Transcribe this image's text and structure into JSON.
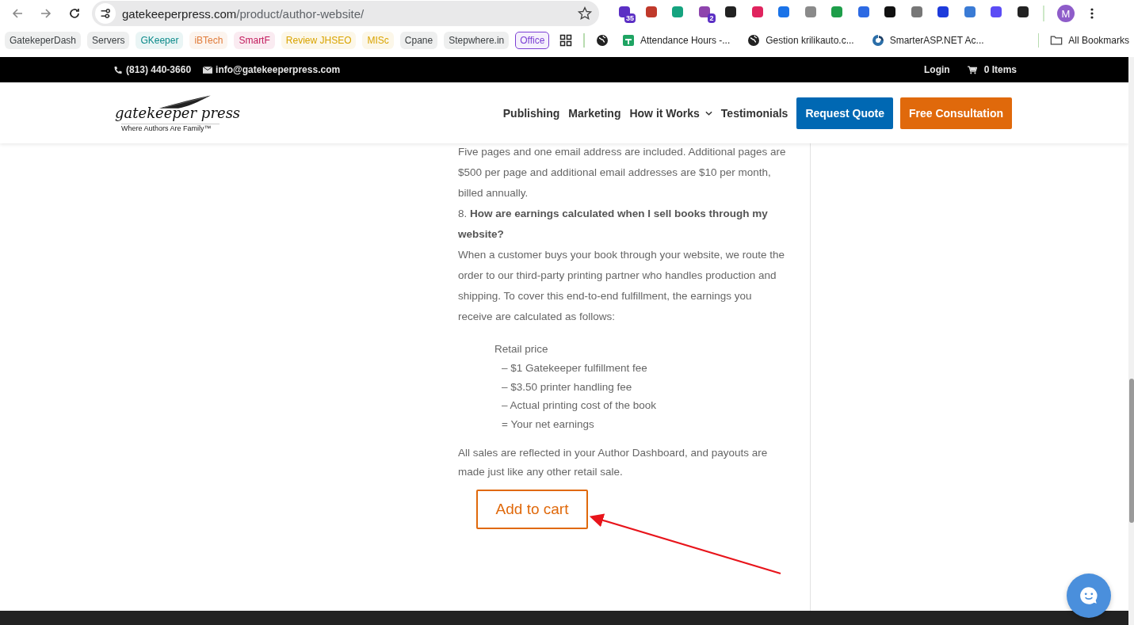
{
  "browser": {
    "url_host": "gatekeeperpress.com",
    "url_path": "/product/author-website/",
    "extensions": [
      {
        "color": "#5b2fc4",
        "badge": "35"
      },
      {
        "color": "#c0392b"
      },
      {
        "color": "#15a37f"
      },
      {
        "color": "#8e44ad",
        "badge": "2"
      },
      {
        "color": "#222222"
      },
      {
        "color": "#e0245e"
      },
      {
        "color": "#1a73e8"
      },
      {
        "color": "#8a8a8a"
      },
      {
        "color": "#1e9e4a"
      },
      {
        "color": "#2d6ae3"
      },
      {
        "color": "#111111"
      },
      {
        "color": "#777777"
      },
      {
        "color": "#1d3bdb"
      },
      {
        "color": "#3a7bd5"
      },
      {
        "color": "#5b4cf5"
      },
      {
        "color": "#222222"
      }
    ],
    "avatar": "M"
  },
  "bookmarks": {
    "chips": [
      {
        "label": "GatekeperDash",
        "color": "#3c4043",
        "kind": "filled"
      },
      {
        "label": "Servers",
        "color": "#3c4043",
        "kind": "filled"
      },
      {
        "label": "GKeeper",
        "color": "#0b8a8a",
        "kind": "filled"
      },
      {
        "label": "iBTech",
        "color": "#e07b39",
        "kind": "filled"
      },
      {
        "label": "SmartF",
        "color": "#c2185b",
        "kind": "filled"
      },
      {
        "label": "Review JHSEO",
        "color": "#d9a400",
        "kind": "filled"
      },
      {
        "label": "MISc",
        "color": "#d9a400",
        "kind": "filled"
      },
      {
        "label": "Cpane",
        "color": "#3c4043",
        "kind": "filled"
      },
      {
        "label": "Stepwhere.in",
        "color": "#3c4043",
        "kind": "filled"
      },
      {
        "label": "Office",
        "color": "#7b3fd4",
        "kind": "outlined"
      }
    ],
    "links": [
      {
        "kind": "globe"
      },
      {
        "kind": "sheet",
        "label": "Attendance Hours -..."
      },
      {
        "kind": "globe",
        "label": "Gestion krilikauto.c..."
      },
      {
        "kind": "swirl",
        "label": "SmarterASP.NET Ac..."
      }
    ],
    "all_label": "All Bookmarks"
  },
  "topbar": {
    "phone": "(813) 440-3660",
    "email": "info@gatekeeperpress.com",
    "login": "Login",
    "cart": "0 Items"
  },
  "header": {
    "logo": "gatekeeper press",
    "tagline": "Where Authors Are Family™",
    "nav": [
      {
        "label": "Publishing",
        "has_menu": false
      },
      {
        "label": "Marketing",
        "has_menu": false
      },
      {
        "label": "How it Works",
        "has_menu": true
      },
      {
        "label": "Testimonials",
        "has_menu": false
      }
    ],
    "buttons": [
      {
        "label": "Request Quote",
        "color": "#0068b3"
      },
      {
        "label": "Free Consultation",
        "color": "#e0690b"
      }
    ]
  },
  "content": [
    {
      "kind": "para",
      "text": "Five pages and one email address are included. Additional pages are $500 per page and additional email addresses are $10 per month, billed annually."
    },
    {
      "kind": "para",
      "text": "8. **How are earnings calculated when I sell books through my website?**"
    },
    {
      "kind": "para",
      "text": "When a customer buys your book through your website, we route the order to our third-party printing partner who handles production and shipping. To cover this end-to-end fulfillment, the earnings you receive are calculated as follows:"
    },
    {
      "kind": "formula",
      "lines": [
        "Retail price",
        "– $1 Gatekeeper fulfillment fee",
        "– $3.50 printer handling fee",
        "– Actual printing cost of the book",
        "= Your net earnings"
      ]
    },
    {
      "kind": "note",
      "text": "All sales are reflected in your Author Dashboard, and payouts are made just like any other retail sale."
    }
  ],
  "add_to_cart": "Add to cart"
}
